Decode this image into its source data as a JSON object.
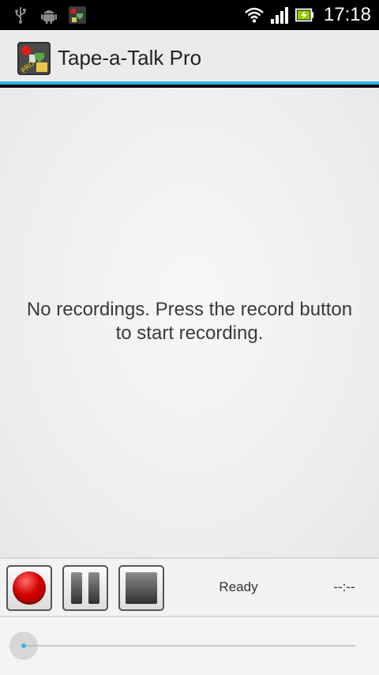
{
  "status_bar": {
    "time": "17:18",
    "icons": [
      "usb-icon",
      "android-debug-icon",
      "app-notification-icon",
      "wifi-icon",
      "signal-icon",
      "battery-charging-icon"
    ]
  },
  "action_bar": {
    "title": "Tape-a-Talk Pro",
    "icon": "tape-a-talk-app-icon"
  },
  "main": {
    "empty_message": "No recordings. Press the record button\nto start recording."
  },
  "controls": {
    "record_icon": "record-icon",
    "pause_icon": "pause-icon",
    "stop_icon": "stop-icon",
    "status": "Ready",
    "time": "--:--"
  },
  "seek": {
    "progress": 0
  },
  "colors": {
    "accent": "#33b5e5",
    "record": "#d40000"
  }
}
